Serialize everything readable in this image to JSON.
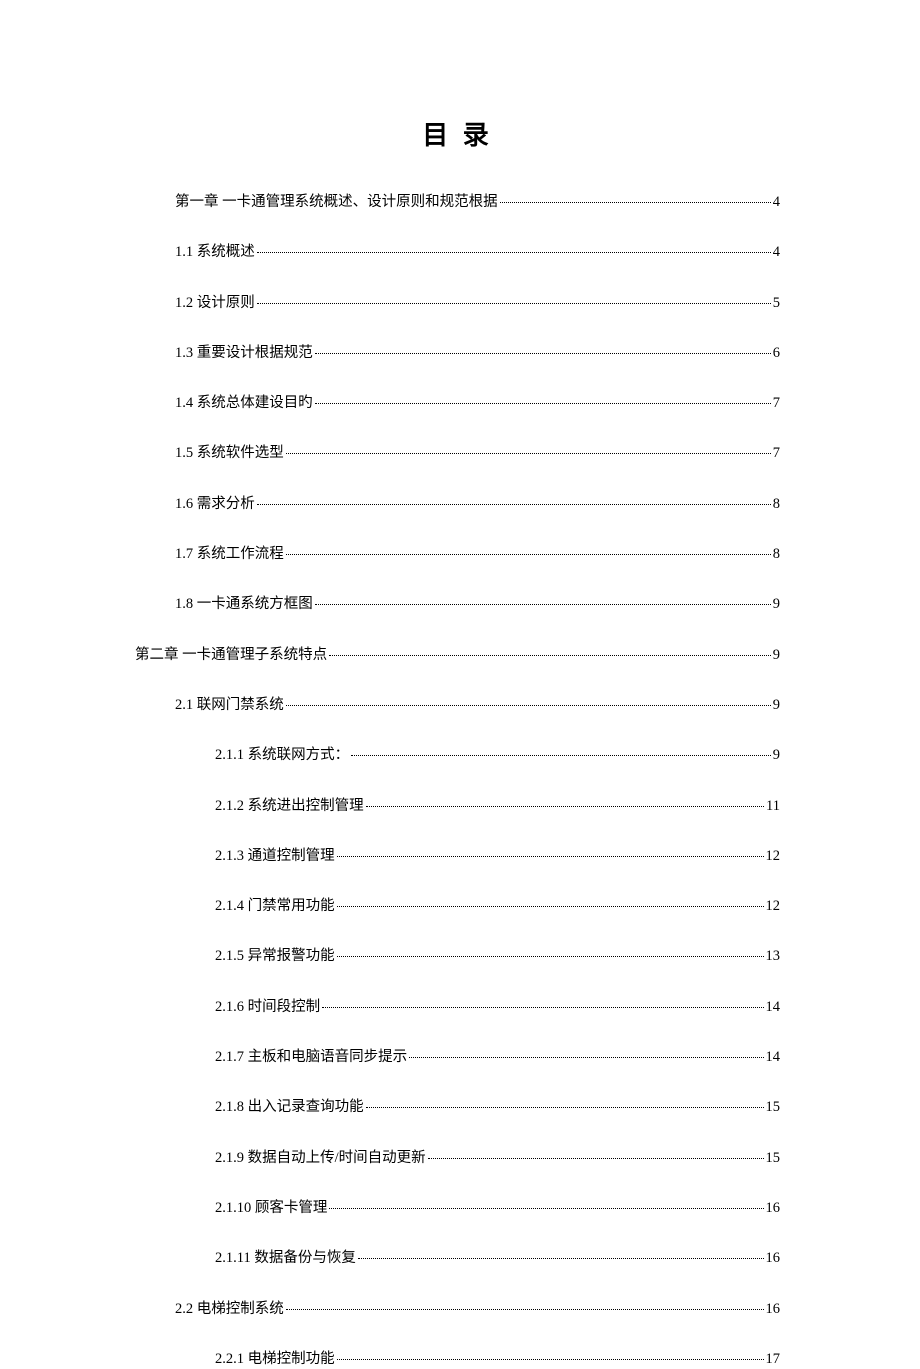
{
  "title": "目 录",
  "toc": [
    {
      "label": "第一章   一卡通管理系统概述、设计原则和规范根据 ",
      "page": "4",
      "indent": 1
    },
    {
      "label": "1.1  系统概述",
      "page": "4",
      "indent": 2
    },
    {
      "label": "1.2  设计原则",
      "page": "5",
      "indent": 2
    },
    {
      "label": "1.3 重要设计根据规范",
      "page": "6",
      "indent": 2
    },
    {
      "label": "1.4 系统总体建设目旳",
      "page": "7",
      "indent": 2
    },
    {
      "label": "1.5 系统软件选型",
      "page": "7",
      "indent": 2
    },
    {
      "label": "1.6 需求分析",
      "page": "8",
      "indent": 2
    },
    {
      "label": "1.7 系统工作流程",
      "page": "8",
      "indent": 2
    },
    {
      "label": "1.8 一卡通系统方框图",
      "page": "9",
      "indent": 2
    },
    {
      "label": "第二章  一卡通管理子系统特点",
      "page": "9",
      "indent": 0
    },
    {
      "label": "2.1 联网门禁系统",
      "page": "9",
      "indent": 2
    },
    {
      "label": "2.1.1 系统联网方式： ",
      "page": "9",
      "indent": 3
    },
    {
      "label": "2.1.2 系统进出控制管理 ",
      "page": "11",
      "indent": 3
    },
    {
      "label": "2.1.3 通道控制管理 ",
      "page": "12",
      "indent": 3
    },
    {
      "label": "2.1.4 门禁常用功能 ",
      "page": "12",
      "indent": 3
    },
    {
      "label": "2.1.5 异常报警功能 ",
      "page": "13",
      "indent": 3
    },
    {
      "label": "2.1.6 时间段控制 ",
      "page": "14",
      "indent": 3
    },
    {
      "label": "2.1.7 主板和电脑语音同步提示 ",
      "page": "14",
      "indent": 3
    },
    {
      "label": "2.1.8 出入记录查询功能 ",
      "page": "15",
      "indent": 3
    },
    {
      "label": "2.1.9 数据自动上传/时间自动更新 ",
      "page": "15",
      "indent": 3
    },
    {
      "label": "2.1.10 顾客卡管理 ",
      "page": "16",
      "indent": 3
    },
    {
      "label": "2.1.11 数据备份与恢复 ",
      "page": "16",
      "indent": 3
    },
    {
      "label": "2.2 电梯控制系统",
      "page": "16",
      "indent": 2
    },
    {
      "label": "2.2.1 电梯控制功能 ",
      "page": "17",
      "indent": 3
    }
  ]
}
